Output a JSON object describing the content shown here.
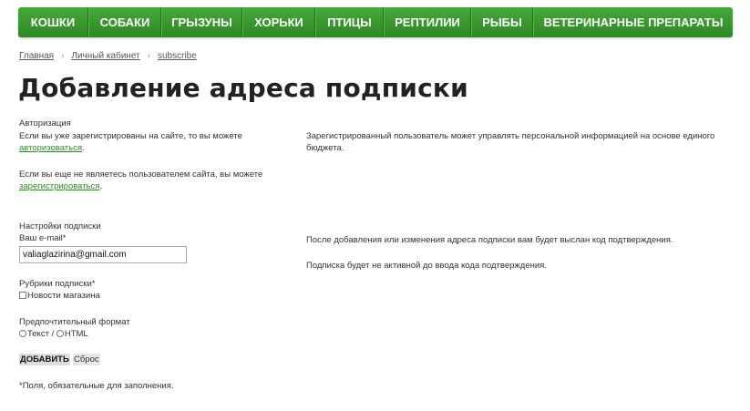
{
  "nav": {
    "items": [
      "Кошки",
      "Собаки",
      "Грызуны",
      "Хорьки",
      "Птицы",
      "Рептилии",
      "Рыбы",
      "Ветеринарные препараты"
    ]
  },
  "breadcrumb": {
    "home": "Главная",
    "account": "Личный кабинет",
    "current": "subscribe",
    "separator": "›"
  },
  "page_title": "Добавление адреса подписки",
  "auth": {
    "heading": "Авторизация",
    "registered_text": "Если вы уже зарегистрированы на сайте, то вы можете",
    "login_link": "авторизоваться",
    "not_registered_text": "Если вы еще не являетесь пользователем сайта, вы можете",
    "register_link": "зарегистрироваться",
    "period": ".",
    "info_line1": "Зарегистрированный пользователь может управлять персональной информацией на основе единого",
    "info_line2": "бюджета."
  },
  "settings": {
    "heading": "Настройки подписки",
    "email_label": "Ваш e-mail*",
    "email_value": "valiaglazirina@gmail.com",
    "rubrics_label": "Рубрики подписки*",
    "rubric_store_news": "Новости магазина",
    "format_label": "Предпочтительный формат",
    "format_text": "Текст",
    "format_separator": "/",
    "format_html": "HTML",
    "note1": "После добавления или изменения адреса подписки вам будет выслан код подтверждения.",
    "note2": "Подписка будет не активной до ввода кода подтверждения."
  },
  "buttons": {
    "add": "ДОБАВИТЬ",
    "reset": "Сброс"
  },
  "footnote": "*Поля, обязательные для заполнения.",
  "colors": {
    "nav_green": "#2c8a22",
    "link_green": "#2a8f20"
  }
}
